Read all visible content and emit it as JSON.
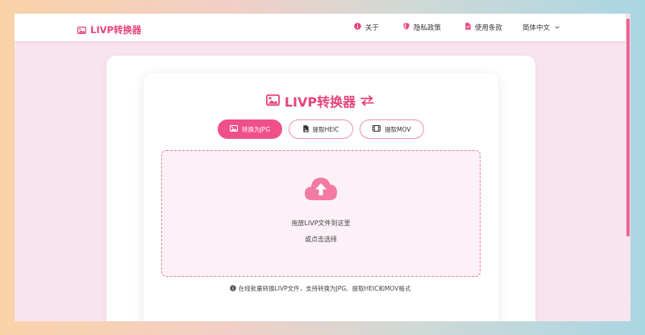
{
  "navbar": {
    "brand": "LIVP转换器",
    "links": [
      {
        "label": "关于",
        "icon": "info-icon"
      },
      {
        "label": "隐私政策",
        "icon": "shield-icon"
      },
      {
        "label": "使用条款",
        "icon": "document-icon"
      }
    ],
    "language": "简体中文"
  },
  "main": {
    "title": "LIVP转换器",
    "tabs": [
      {
        "label": "转换为JPG",
        "icon": "image-icon",
        "active": true
      },
      {
        "label": "提取HEIC",
        "icon": "file-image-icon",
        "active": false
      },
      {
        "label": "提取MOV",
        "icon": "film-icon",
        "active": false
      }
    ],
    "dropzone": {
      "primary": "拖放LIVP文件到这里",
      "secondary": "或点击选择"
    },
    "footnote": "在线批量转换LIVP文件，支持转换为JPG、提取HEIC和MOV格式"
  },
  "colors": {
    "accent": "#e8437b",
    "tab_active_bg": "#f0508a",
    "dropzone_border": "#f07aa3",
    "dropzone_bg": "#fcf1f7"
  }
}
